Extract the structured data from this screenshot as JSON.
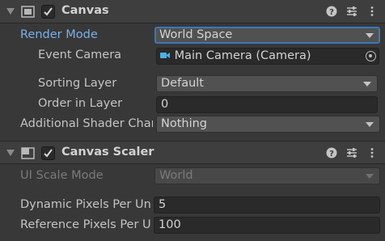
{
  "canvas": {
    "title": "Canvas",
    "enabled": true,
    "render_mode": {
      "label": "Render Mode",
      "value": "World Space"
    },
    "event_camera": {
      "label": "Event Camera",
      "value": "Main Camera (Camera)"
    },
    "sorting_layer": {
      "label": "Sorting Layer",
      "value": "Default"
    },
    "order_in_layer": {
      "label": "Order in Layer",
      "value": "0"
    },
    "additional_shader_channels": {
      "label": "Additional Shader Char",
      "value": "Nothing"
    }
  },
  "canvas_scaler": {
    "title": "Canvas Scaler",
    "enabled": true,
    "ui_scale_mode": {
      "label": "UI Scale Mode",
      "value": "World"
    },
    "dynamic_pixels": {
      "label": "Dynamic Pixels Per Un",
      "value": "5"
    },
    "reference_pixels": {
      "label": "Reference Pixels Per U",
      "value": "100"
    }
  },
  "icons": {
    "foldout": "foldout-arrow-icon",
    "canvas": "canvas-component-icon",
    "canvas_scaler": "canvas-scaler-component-icon",
    "help": "help-icon",
    "presets": "presets-icon",
    "menu": "kebab-menu-icon",
    "camera": "camera-icon",
    "picker": "object-picker-icon"
  },
  "colors": {
    "background": "#383838",
    "header": "#3e3e3e",
    "active_label": "#7bafe8",
    "focus_border": "#3a79bb"
  }
}
